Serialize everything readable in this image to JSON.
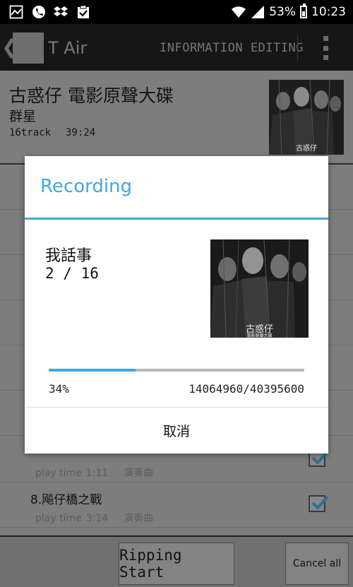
{
  "status_bar": {
    "battery": "53%",
    "time": "10:23",
    "icons": [
      "gallery-icon",
      "phone-icon",
      "dropbox-icon",
      "clipboard-check-icon",
      "wifi-icon",
      "signal-icon",
      "battery-icon"
    ]
  },
  "action_bar": {
    "back_glyph": "❮",
    "app_title": "T Air",
    "action_label": "INFORMATION EDITING",
    "menu_icon": "overflow-menu-icon"
  },
  "album": {
    "title": "古惑仔 電影原聲大碟",
    "artist": "群星",
    "tracks": "16track",
    "duration": "39:24",
    "cover_text": "古惑仔"
  },
  "tracks": [
    {
      "name": "",
      "play_label": "play time",
      "time": "1:11",
      "genre": "演奏曲",
      "checked": true
    },
    {
      "name": "8.飚仔橋之戰",
      "play_label": "play time",
      "time": "3:14",
      "genre": "演奏曲",
      "checked": true
    }
  ],
  "bottom": {
    "rip_label": "Ripping Start",
    "cancel_all_label": "Cancel all"
  },
  "dialog": {
    "title": "Recording",
    "song": "我話事",
    "count": "2 / 16",
    "cover_text": "古惑仔",
    "cover_subtext": "電影原聲大碟",
    "progress": 0.34,
    "percent": "34%",
    "bytes": "14064960/40395600",
    "cancel_label": "取消"
  },
  "colors": {
    "accent": "#42a9d9",
    "dim_bg": "#7d7d7d"
  }
}
